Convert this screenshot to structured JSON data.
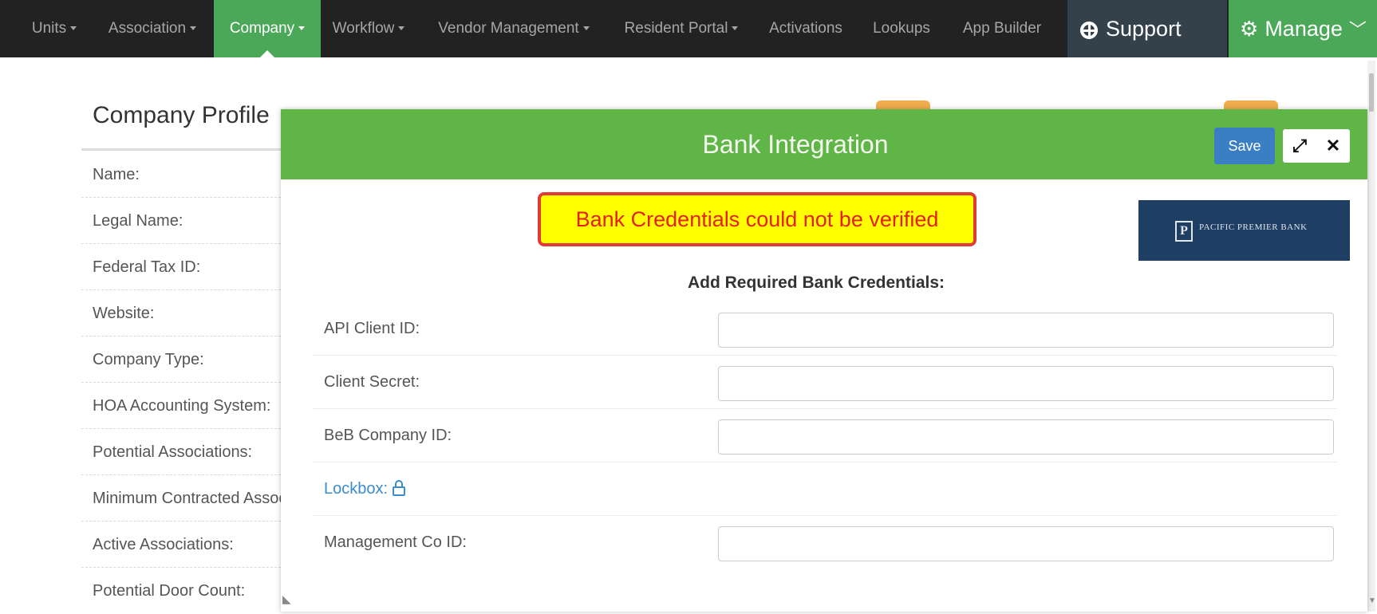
{
  "nav": {
    "items": [
      {
        "label": "Units",
        "caret": true
      },
      {
        "label": "Association",
        "caret": true
      },
      {
        "label": "Company",
        "caret": true,
        "active": true
      },
      {
        "label": "Workflow",
        "caret": true
      },
      {
        "label": "Vendor Management",
        "caret": true
      },
      {
        "label": "Resident Portal",
        "caret": true
      },
      {
        "label": "Activations",
        "caret": false
      },
      {
        "label": "Lookups",
        "caret": false
      },
      {
        "label": "App Builder",
        "caret": false
      }
    ],
    "support_label": "Support",
    "manage_label": "Manage",
    "active_color": "#4ca859",
    "bar_color": "#222222"
  },
  "page": {
    "title": "Company Profile",
    "rows": [
      "Name:",
      "Legal Name:",
      "Federal Tax ID:",
      "Website:",
      "Company Type:",
      "HOA Accounting System:",
      "Potential Associations:",
      "Minimum Contracted Associations:",
      "Active Associations:",
      "Potential Door Count:"
    ]
  },
  "modal": {
    "title": "Bank Integration",
    "save_label": "Save",
    "header_color": "#5fb545",
    "alert_text": "Bank Credentials could not be verified",
    "bank_logo_text": "PACIFIC PREMIER BANK",
    "bank_logo_mark": "P",
    "section_title": "Add Required Bank Credentials:",
    "fields": [
      {
        "label": "API Client ID:",
        "value": ""
      },
      {
        "label": "Client Secret:",
        "value": ""
      },
      {
        "label": "BeB Company ID:",
        "value": ""
      }
    ],
    "lockbox_label": "Lockbox:",
    "management_field": {
      "label": "Management Co ID:",
      "value": ""
    }
  }
}
